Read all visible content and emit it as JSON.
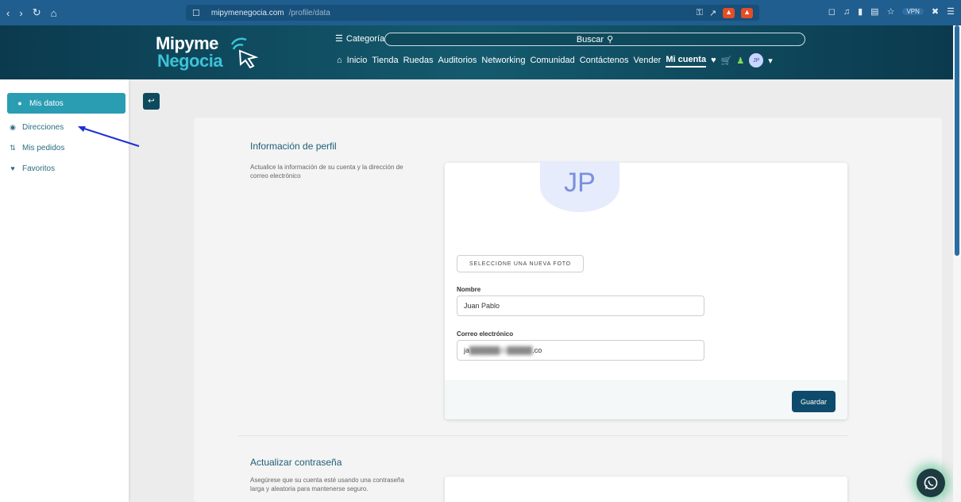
{
  "browser": {
    "url_site": "mipymenegocia.com",
    "url_path": "/profile/data",
    "vpn_label": "VPN"
  },
  "header": {
    "logo_top": "Mipyme",
    "logo_bottom": "Negocia",
    "categories_label": "Categorías",
    "search_label": "Buscar",
    "nav": [
      "Inicio",
      "Tienda",
      "Ruedas",
      "Auditorios",
      "Networking",
      "Comunidad",
      "Contáctenos",
      "Vender"
    ],
    "nav_active": "Mi cuenta",
    "avatar_initials": "JP"
  },
  "sidebar": {
    "items": [
      {
        "label": "Mis datos",
        "icon": "user-icon"
      },
      {
        "label": "Direcciones",
        "icon": "map-pin-icon"
      },
      {
        "label": "Mis pedidos",
        "icon": "sort-icon"
      },
      {
        "label": "Favoritos",
        "icon": "heart-icon"
      }
    ]
  },
  "profile": {
    "title": "Información de perfil",
    "description": "Actualice la información de su cuenta y la dirección de correo electrónico",
    "avatar_initials": "JP",
    "photo_button": "SELECCIONE UNA NUEVA FOTO",
    "name_label": "Nombre",
    "name_value": "Juan Pablo",
    "email_label": "Correo electrónico",
    "email_prefix": "ja",
    "email_suffix": ".co",
    "save_button": "Guardar"
  },
  "password": {
    "title": "Actualizar contraseña",
    "description": "Asegúrese que su cuenta esté usando una contraseña larga y aleatoria para mantenerse seguro."
  },
  "colors": {
    "header_bg": "#0b3a4e",
    "accent": "#2a9db3",
    "primary_button": "#0e4a6b"
  }
}
